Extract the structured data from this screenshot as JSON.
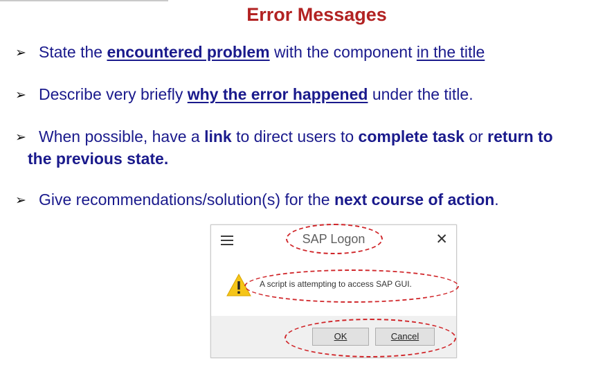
{
  "slide": {
    "title": "Error Messages",
    "bullets": [
      {
        "parts": [
          "State the ",
          "encountered problem",
          " with the component ",
          "in the title"
        ]
      },
      {
        "parts": [
          "Describe very briefly ",
          "why the error happened",
          " under the title."
        ]
      },
      {
        "parts": [
          "When possible, have a ",
          "link",
          " to direct users to  ",
          "complete  task",
          " or ",
          "return to",
          "the previous state."
        ]
      },
      {
        "parts": [
          "Give recommendations/solution(s) for the ",
          "next course of action",
          "."
        ]
      }
    ]
  },
  "dialog": {
    "title": "SAP Logon",
    "message": "A script is attempting to access SAP GUI.",
    "ok_label": "OK",
    "cancel_label": "Cancel",
    "menu_icon": "hamburger-menu-icon",
    "close_icon": "close-icon",
    "warning_icon": "warning-icon"
  },
  "colors": {
    "title": "#b22222",
    "body_text": "#1a1a8c",
    "annotation": "#d0262a",
    "warning_fill": "#f5c518"
  }
}
